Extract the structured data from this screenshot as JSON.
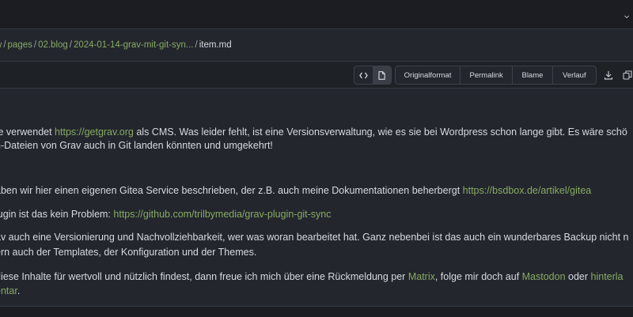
{
  "breadcrumb": {
    "items": [
      "w",
      "pages",
      "02.blog",
      "2024-01-14-grav-mit-git-syn..."
    ],
    "separator": "/",
    "current": "item.md"
  },
  "toolbar": {
    "buttons": [
      "Originalformat",
      "Permalink",
      "Blame",
      "Verlauf"
    ],
    "icons": [
      "code-icon",
      "file-icon",
      "download-icon",
      "copy-icon"
    ]
  },
  "content": {
    "p1a": {
      "pre": "te verwendet ",
      "link": "https://getgrav.org",
      "post": " als CMS. Was leider fehlt, ist eine Versionsverwaltung, wie es sie bei Wordpress schon lange gibt. Es wäre schö"
    },
    "p1b": "n-Dateien von Grav auch in Git landen könnten und umgekehrt!",
    "p2": {
      "pre": "aben wir hier einen eigenen Gitea Service beschrieben, der z.B. auch meine Dokumentationen beherbergt ",
      "link": "https://bsdbox.de/artikel/gitea"
    },
    "p3": {
      "pre": "lugin ist das kein Problem: ",
      "link": "https://github.com/trilbymedia/grav-plugin-git-sync"
    },
    "p4a": "av auch eine Versionierung und Nachvollziehbarkeit, wer was woran bearbeitet hat. Ganz nebenbei ist das auch ein wunderbares Backup nicht n",
    "p4b": "ern auch der Templates, der Konfiguration und der Themes.",
    "p5a": {
      "pre": "diese Inhalte für wertvoll und nützlich findest, dann freue ich mich über eine Rückmeldung per ",
      "link1": "Matrix",
      "mid": ", folge mir doch auf ",
      "link2": "Mastodon",
      "mid2": " oder ",
      "link3": "hinterla"
    },
    "p5b": {
      "link": "entar",
      "post": "."
    }
  },
  "colors": {
    "link": "#87ab63",
    "background": "#23262d",
    "text": "#d7dae0"
  }
}
